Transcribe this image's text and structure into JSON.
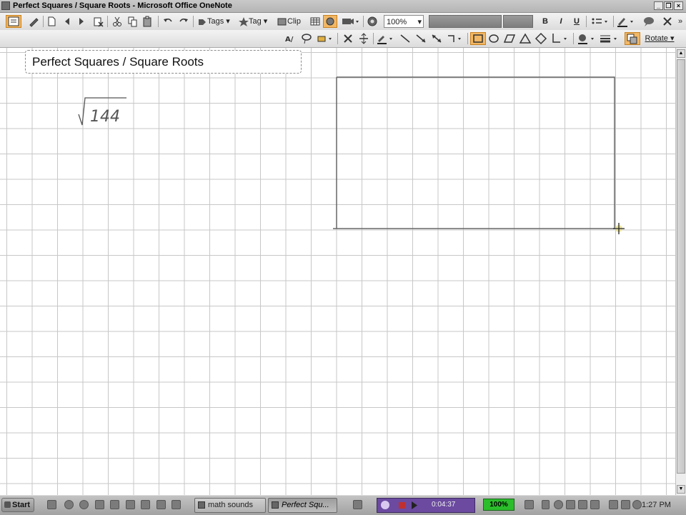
{
  "window": {
    "title": "Perfect Squares / Square Roots - Microsoft Office OneNote",
    "minimize": "_",
    "restore": "❐",
    "close": "×"
  },
  "toolbar1": {
    "tags_label": "Tags",
    "tag_label": "Tag",
    "clip_label": "Clip",
    "zoom_value": "100%",
    "bold": "B",
    "italic": "I",
    "underline": "U"
  },
  "toolbar2": {
    "rotate_label": "Rotate"
  },
  "page": {
    "title": "Perfect Squares / Square Roots",
    "handwritten_number": "144"
  },
  "taskbar": {
    "start_label": "Start",
    "task1_label": "math sounds",
    "task2_label": "Perfect Squ...",
    "recorder_time": "0:04:37",
    "battery_label": "100%",
    "clock": "1:27 PM"
  },
  "colors": {
    "active_tool": "#f2b764",
    "grid_line": "#c7c7c7",
    "drawn_rectangle": "#666666",
    "battery_green": "#2bbd2b",
    "recorder_purple": "#6b4aa0"
  },
  "icons": {
    "cursor": "crosshair-cursor-icon"
  }
}
